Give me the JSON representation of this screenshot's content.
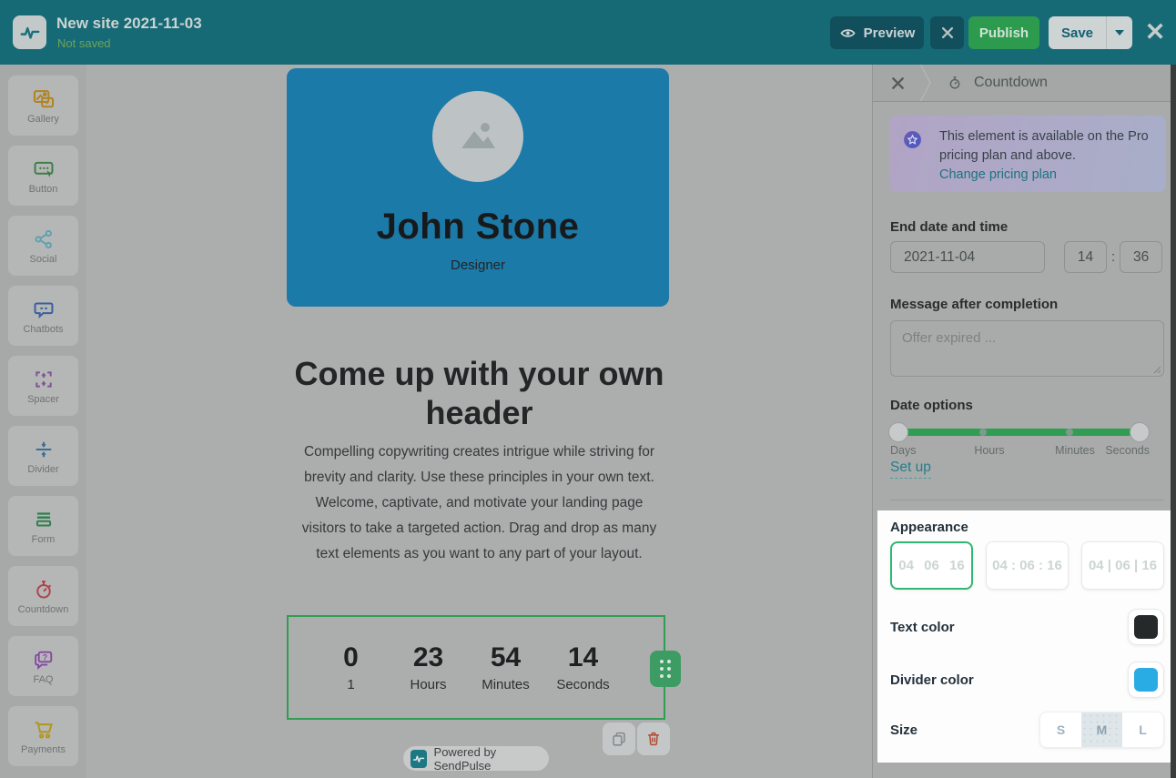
{
  "colors": {
    "header_teal": "#166a75",
    "publish_green": "#2d9b4e",
    "selection_green": "#2fa35a",
    "text_color_swatch": "#25292a",
    "divider_color_swatch": "#29abe3"
  },
  "header": {
    "title": "New site 2021-11-03",
    "status": "Not saved",
    "preview": "Preview",
    "publish": "Publish",
    "save": "Save"
  },
  "sidebar": {
    "items": [
      {
        "label": "Gallery"
      },
      {
        "label": "Button"
      },
      {
        "label": "Social"
      },
      {
        "label": "Chatbots"
      },
      {
        "label": "Spacer"
      },
      {
        "label": "Divider"
      },
      {
        "label": "Form"
      },
      {
        "label": "Countdown"
      },
      {
        "label": "FAQ"
      },
      {
        "label": "Payments"
      }
    ]
  },
  "canvas": {
    "profile": {
      "name": "John Stone",
      "role": "Designer"
    },
    "heading": "Come up with your own header",
    "paragraph": "Compelling copywriting creates intrigue while striving for brevity and clarity. Use these principles in your own text. Welcome, captivate, and motivate your landing page visitors to take a targeted action. Drag and drop as many text elements as you want to any part of your layout.",
    "countdown": {
      "units": [
        {
          "value": "0",
          "label": "1"
        },
        {
          "value": "23",
          "label": "Hours"
        },
        {
          "value": "54",
          "label": "Minutes"
        },
        {
          "value": "14",
          "label": "Seconds"
        }
      ]
    },
    "powered_by": "Powered by SendPulse"
  },
  "panel": {
    "breadcrumb": {
      "title": "Countdown"
    },
    "notice": {
      "text": "This element is available on the Pro pricing plan and above.",
      "link": "Change pricing plan"
    },
    "end_date": {
      "label": "End date and time",
      "date": "2021-11-04",
      "hour": "14",
      "separator": ":",
      "minute": "36"
    },
    "message": {
      "label": "Message after completion",
      "placeholder": "Offer expired ..."
    },
    "date_options": {
      "label": "Date options",
      "ticks": [
        "Days",
        "Hours",
        "Minutes",
        "Seconds"
      ],
      "set_up": "Set up"
    },
    "appearance": {
      "label": "Appearance",
      "styles": [
        "04 06 16",
        "04 : 06 : 16",
        "04 | 06 | 16"
      ]
    },
    "text_color_label": "Text color",
    "divider_color_label": "Divider color",
    "size": {
      "label": "Size",
      "options": [
        "S",
        "M",
        "L"
      ],
      "selected": "M"
    }
  }
}
